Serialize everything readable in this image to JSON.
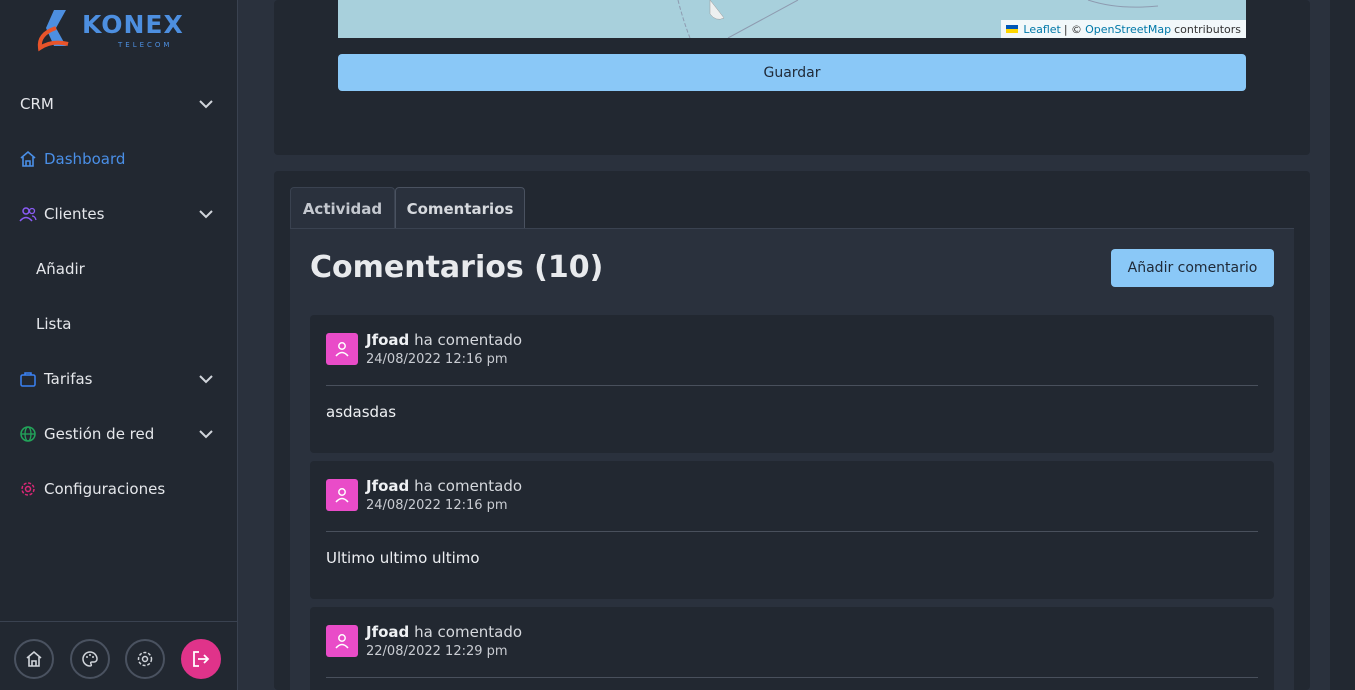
{
  "brand": {
    "name": "KONEX",
    "sub": "TELECOM"
  },
  "sidebar": {
    "items": [
      {
        "label": "CRM",
        "icon": "none",
        "chevron": true
      },
      {
        "label": "Dashboard",
        "icon": "home-icon",
        "active": true
      },
      {
        "label": "Clientes",
        "icon": "users-icon",
        "chevron": true
      },
      {
        "label": "Añadir",
        "sub": true
      },
      {
        "label": "Lista",
        "sub": true
      },
      {
        "label": "Tarifas",
        "icon": "briefcase-icon",
        "chevron": true
      },
      {
        "label": "Gestión de red",
        "icon": "globe-icon",
        "chevron": true
      },
      {
        "label": "Configuraciones",
        "icon": "gear-icon"
      }
    ],
    "bottom": [
      "home-icon",
      "palette-icon",
      "gear-icon",
      "logout-icon"
    ]
  },
  "map": {
    "attribution_leaflet": "Leaflet",
    "attribution_sep": "| ©",
    "attribution_osm": "OpenStreetMap",
    "attribution_tail": "contributors"
  },
  "form": {
    "save_label": "Guardar"
  },
  "tabs": [
    {
      "label": "Actividad"
    },
    {
      "label": "Comentarios",
      "active": true
    }
  ],
  "comments_panel": {
    "title": "Comentarios (10)",
    "add_label": "Añadir comentario",
    "items": [
      {
        "author": "Jfoad",
        "action": "ha comentado",
        "date": "24/08/2022 12:16 pm",
        "body": "asdasdas"
      },
      {
        "author": "Jfoad",
        "action": "ha comentado",
        "date": "24/08/2022 12:16 pm",
        "body": "Ultimo ultimo ultimo"
      },
      {
        "author": "Jfoad",
        "action": "ha comentado",
        "date": "22/08/2022 12:29 pm",
        "body": ""
      }
    ]
  },
  "colors": {
    "accent": "#8ac8f7",
    "active_nav": "#4a8fe7",
    "avatar": "#e94cc8",
    "logout": "#e0338a"
  }
}
